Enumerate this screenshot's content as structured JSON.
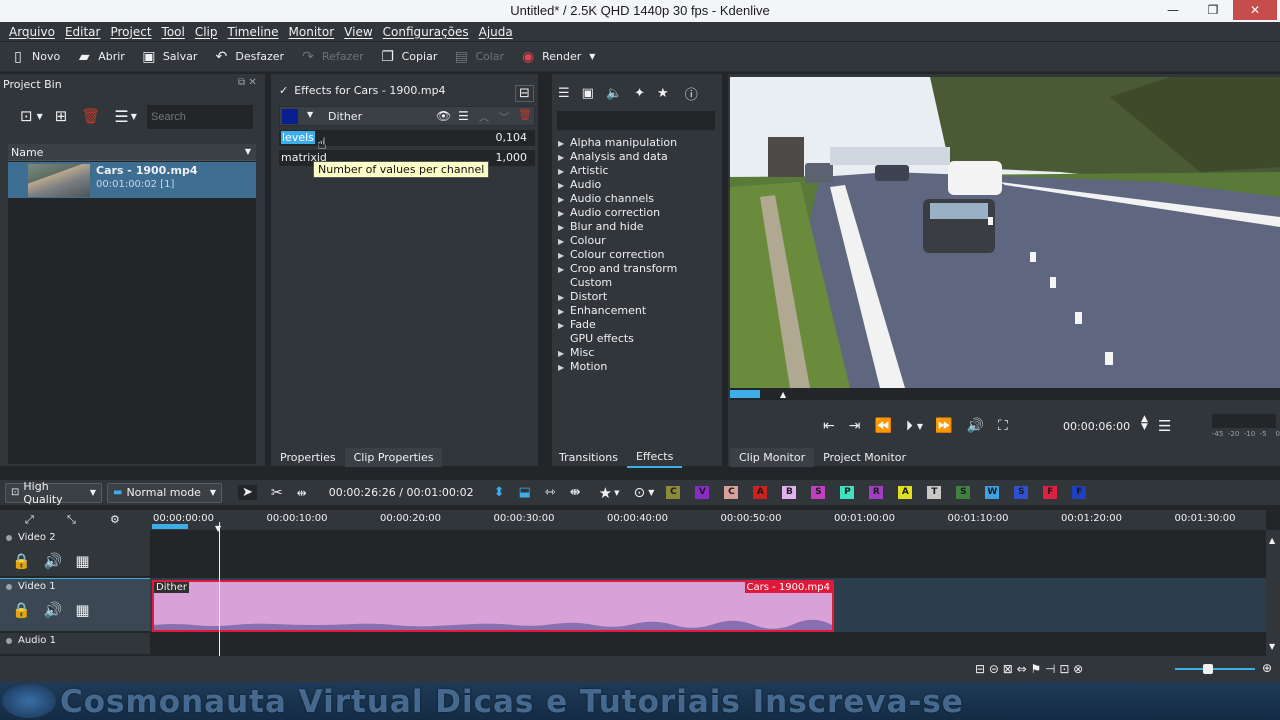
{
  "window": {
    "title": "Untitled* / 2.5K QHD 1440p 30 fps - Kdenlive",
    "minimize": "—",
    "maximize": "❐",
    "close": "✕"
  },
  "menu": [
    "Arquivo",
    "Editar",
    "Project",
    "Tool",
    "Clip",
    "Timeline",
    "Monitor",
    "View",
    "Configurações",
    "Ajuda"
  ],
  "toolbar": {
    "new": "Novo",
    "open": "Abrir",
    "save": "Salvar",
    "undo": "Desfazer",
    "redo": "Refazer",
    "copy": "Copiar",
    "paste": "Colar",
    "render": "Render"
  },
  "project_bin": {
    "title": "Project Bin",
    "search_placeholder": "Search",
    "column_name": "Name",
    "clip": {
      "name": "Cars - 1900.mp4",
      "duration": "00:01:00:02  [1]"
    }
  },
  "effect_stack": {
    "header": "Effects for Cars - 1900.mp4",
    "effect_name": "Dither",
    "params": [
      {
        "name": "levels",
        "value": "0,104"
      },
      {
        "name": "matrixid",
        "value": "1,000"
      }
    ],
    "tooltip": "Number of values per channel"
  },
  "effects_list": {
    "categories": [
      {
        "label": "Alpha manipulation",
        "expandable": true
      },
      {
        "label": "Analysis and data",
        "expandable": true
      },
      {
        "label": "Artistic",
        "expandable": true
      },
      {
        "label": "Audio",
        "expandable": true
      },
      {
        "label": "Audio channels",
        "expandable": true
      },
      {
        "label": "Audio correction",
        "expandable": true
      },
      {
        "label": "Blur and hide",
        "expandable": true
      },
      {
        "label": "Colour",
        "expandable": true
      },
      {
        "label": "Colour correction",
        "expandable": true
      },
      {
        "label": "Crop and transform",
        "expandable": true
      },
      {
        "label": "Custom",
        "expandable": false
      },
      {
        "label": "Distort",
        "expandable": true
      },
      {
        "label": "Enhancement",
        "expandable": true
      },
      {
        "label": "Fade",
        "expandable": true
      },
      {
        "label": "GPU effects",
        "expandable": false
      },
      {
        "label": "Misc",
        "expandable": true
      },
      {
        "label": "Motion",
        "expandable": true
      }
    ]
  },
  "monitor": {
    "timecode": "00:00:06:00",
    "meter_scale": "-45  -20  -10  -5    0"
  },
  "tabs": {
    "properties": "Properties",
    "clip_properties": "Clip Properties",
    "transitions": "Transitions",
    "effects": "Effects",
    "clip_monitor": "Clip Monitor",
    "project_monitor": "Project Monitor"
  },
  "timeline_toolbar": {
    "quality": "High Quality",
    "mode": "Normal mode",
    "timecode": "00:00:26:26 / 00:01:00:02",
    "letters": [
      {
        "l": "C",
        "color": "#8a8a3a"
      },
      {
        "l": "V",
        "color": "#8a2bc4"
      },
      {
        "l": "C",
        "color": "#d8a09a"
      },
      {
        "l": "A",
        "color": "#cc2222"
      },
      {
        "l": "B",
        "color": "#e0b0f0"
      },
      {
        "l": "S",
        "color": "#c040c0"
      },
      {
        "l": "P",
        "color": "#40e0c0"
      },
      {
        "l": "R",
        "color": "#a040c0"
      },
      {
        "l": "A",
        "color": "#e0e020"
      },
      {
        "l": "T",
        "color": "#c8c8c8"
      },
      {
        "l": "S",
        "color": "#408040"
      },
      {
        "l": "W",
        "color": "#40a0e0"
      },
      {
        "l": "S",
        "color": "#3050d0"
      },
      {
        "l": "F",
        "color": "#e02040"
      },
      {
        "l": "F",
        "color": "#2040c0"
      }
    ]
  },
  "timeline": {
    "ruler": [
      "00:00:00:00",
      "00:00:10:00",
      "00:00:20:00",
      "00:00:30:00",
      "00:00:40:00",
      "00:00:50:00",
      "00:01:00:00",
      "00:01:10:00",
      "00:01:20:00",
      "00:01:30:00"
    ],
    "tracks": [
      "Video 2",
      "Video 1",
      "Audio 1"
    ],
    "clip_effect": "Dither",
    "clip_name": "Cars - 1900.mp4"
  },
  "watermark": "Cosmonauta Virtual Dicas e Tutoriais Inscreva-se"
}
